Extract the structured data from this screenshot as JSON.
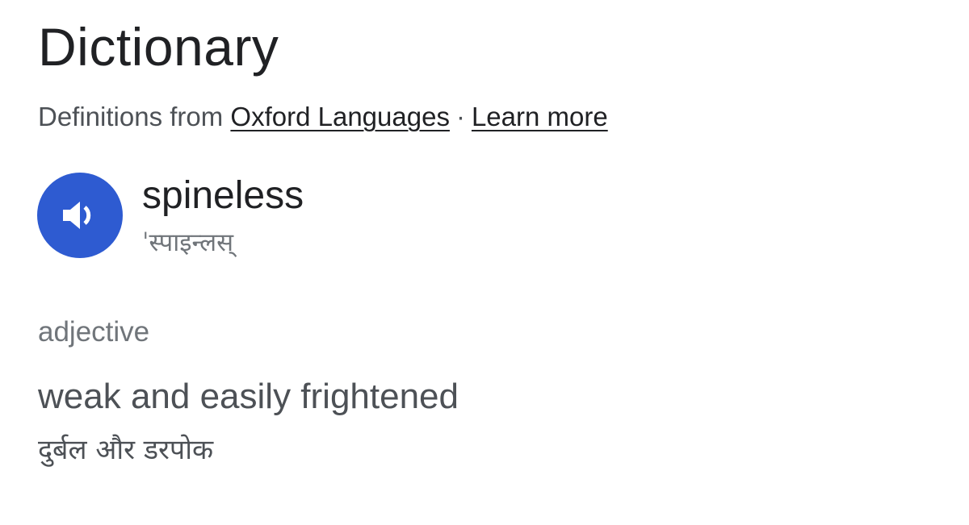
{
  "header": {
    "title": "Dictionary"
  },
  "source": {
    "prefix": "Definitions from",
    "provider_link": "Oxford Languages",
    "separator": "·",
    "learn_more_link": "Learn more"
  },
  "entry": {
    "word": "spineless",
    "phonetic": "ˈस्पाइन्लस्",
    "audio_icon": "speaker-icon",
    "accent_color": "#2e5bd1"
  },
  "sense": {
    "part_of_speech": "adjective",
    "definition": "weak and easily frightened",
    "translation": "दुर्बल और डरपोक"
  }
}
